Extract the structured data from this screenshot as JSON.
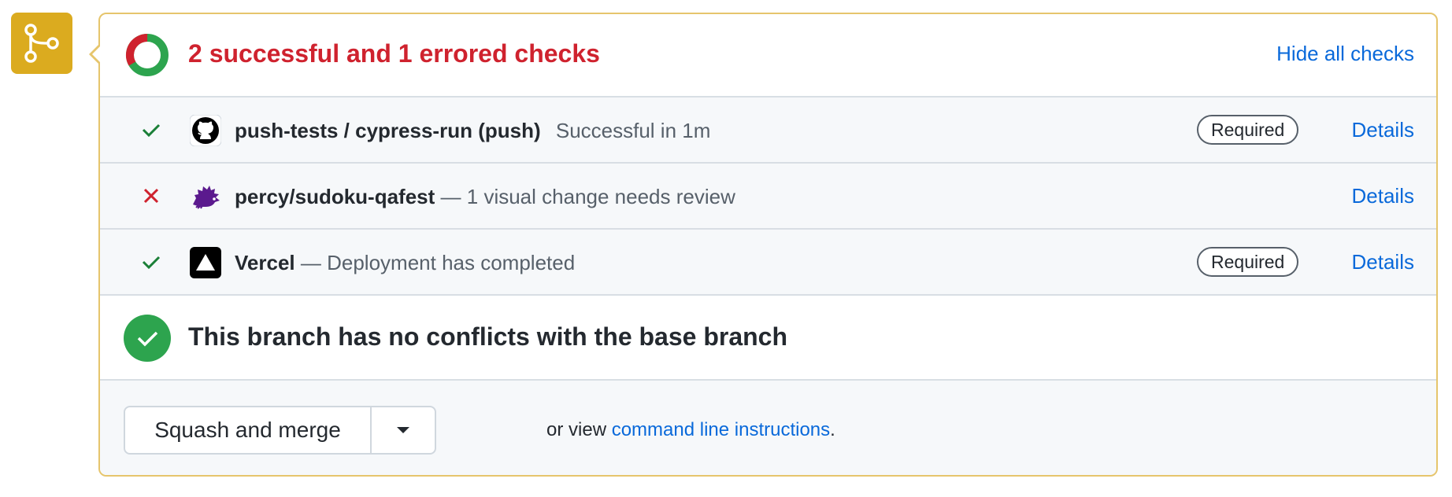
{
  "summary": {
    "title": "2 successful and 1 errored checks",
    "hide_label": "Hide all checks",
    "successful_count": 2,
    "errored_count": 1
  },
  "checks": [
    {
      "name": "push-tests / cypress-run (push)",
      "separator": "",
      "description": "Successful in 1m",
      "status": "success",
      "avatar": "github-icon",
      "required": "Required",
      "details": "Details"
    },
    {
      "name": "percy/sudoku-qafest",
      "separator": "—",
      "description": "1 visual change needs review",
      "status": "error",
      "avatar": "percy-hedgehog-icon",
      "required": "",
      "details": "Details"
    },
    {
      "name": "Vercel",
      "separator": "—",
      "description": "Deployment has completed",
      "status": "success",
      "avatar": "vercel-triangle-icon",
      "required": "Required",
      "details": "Details"
    }
  ],
  "conflicts": {
    "text": "This branch has no conflicts with the base branch"
  },
  "merge": {
    "button_label": "Squash and merge",
    "note_prefix": "or view",
    "note_link": "command line instructions",
    "note_suffix": "."
  },
  "colors": {
    "success": "#1a7f37",
    "error": "#cf222e",
    "link": "#0969da",
    "merge_badge": "#dbab1f",
    "panel_border": "#e6c56c"
  }
}
